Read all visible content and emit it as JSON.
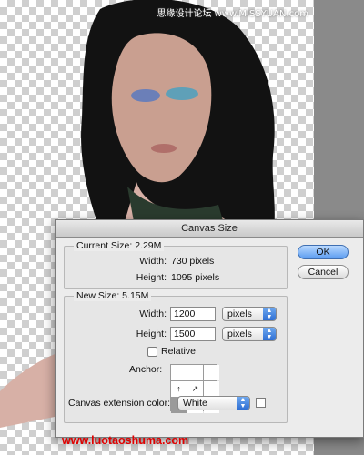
{
  "watermark_top": "思缘设计论坛 www.MISSYUAN.com",
  "dialog": {
    "title": "Canvas Size",
    "current_size": {
      "label": "Current Size: 2.29M",
      "width_label": "Width:",
      "width_value": "730 pixels",
      "height_label": "Height:",
      "height_value": "1095 pixels"
    },
    "new_size": {
      "label": "New Size: 5.15M",
      "width_label": "Width:",
      "width_value": "1200",
      "width_unit": "pixels",
      "height_label": "Height:",
      "height_value": "1500",
      "height_unit": "pixels",
      "relative_label": "Relative",
      "relative_checked": false,
      "anchor_label": "Anchor:"
    },
    "canvas_extension_label": "Canvas extension color:",
    "canvas_extension_value": "White",
    "ok_label": "OK",
    "cancel_label": "Cancel"
  },
  "footer_url": "www.luotaoshuma.com"
}
